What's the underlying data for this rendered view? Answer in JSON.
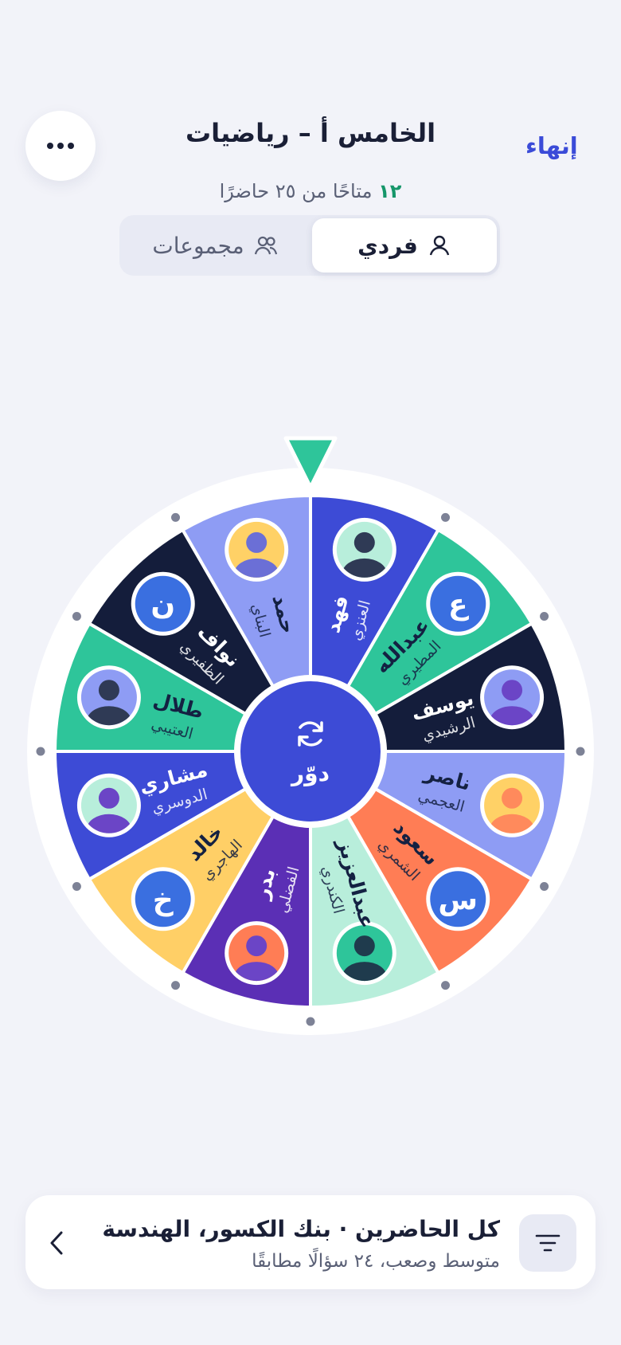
{
  "header": {
    "end_label": "إنهاء",
    "title": "الخامس أ – رياضيات",
    "available_count": "١٢",
    "available_text": "متاحًا من ٢٥ حاضرًا"
  },
  "mode_toggle": {
    "individual_label": "فردي",
    "groups_label": "مجموعات",
    "selected": "individual"
  },
  "wheel": {
    "spin_label": "دوّر",
    "segments": [
      {
        "first": "فهد",
        "last": "العنزي",
        "color": "#3d4bd6",
        "text": "#ffffff",
        "avatar": {
          "kind": "photo",
          "bg": "#b8eedb",
          "head": "#2f3a55",
          "body": "#2f3a55"
        }
      },
      {
        "first": "عبدالله",
        "last": "المطيري",
        "color": "#2ec59a",
        "text": "#142142",
        "avatar": {
          "kind": "initial",
          "letter": "ع",
          "bg": "#3a6fe0"
        }
      },
      {
        "first": "يوسف",
        "last": "الرشيدي",
        "color": "#141d3b",
        "text": "#ffffff",
        "avatar": {
          "kind": "photo",
          "bg": "#8e9cf4",
          "head": "#6b45c6",
          "body": "#6b45c6"
        }
      },
      {
        "first": "ناصر",
        "last": "العجمي",
        "color": "#8e9cf4",
        "text": "#142142",
        "avatar": {
          "kind": "photo",
          "bg": "#ffd166",
          "head": "#ff8a5c",
          "body": "#ff8a5c"
        }
      },
      {
        "first": "سعود",
        "last": "الشمري",
        "color": "#ff7d55",
        "text": "#142142",
        "avatar": {
          "kind": "initial",
          "letter": "س",
          "bg": "#3a6fe0"
        }
      },
      {
        "first": "عبدالعزيز",
        "last": "الكندري",
        "color": "#b8eedb",
        "text": "#142142",
        "avatar": {
          "kind": "photo",
          "bg": "#2ec59a",
          "head": "#1f3b4d",
          "body": "#1f3b4d"
        }
      },
      {
        "first": "بدر",
        "last": "الفضلي",
        "color": "#5b2fb5",
        "text": "#ffffff",
        "avatar": {
          "kind": "photo",
          "bg": "#ff7d55",
          "head": "#6b45c6",
          "body": "#6b45c6"
        }
      },
      {
        "first": "خالد",
        "last": "الهاجري",
        "color": "#ffcf66",
        "text": "#142142",
        "avatar": {
          "kind": "initial",
          "letter": "خ",
          "bg": "#3a6fe0"
        }
      },
      {
        "first": "مشاري",
        "last": "الدوسري",
        "color": "#3d4bd6",
        "text": "#ffffff",
        "avatar": {
          "kind": "photo",
          "bg": "#b8eedb",
          "head": "#6b45c6",
          "body": "#6b45c6"
        }
      },
      {
        "first": "طلال",
        "last": "العتيبي",
        "color": "#2ec59a",
        "text": "#142142",
        "avatar": {
          "kind": "photo",
          "bg": "#8e9cf4",
          "head": "#2f3a55",
          "body": "#2f3a55"
        }
      },
      {
        "first": "نواف",
        "last": "الظفيري",
        "color": "#141d3b",
        "text": "#ffffff",
        "avatar": {
          "kind": "initial",
          "letter": "ن",
          "bg": "#3a6fe0"
        }
      },
      {
        "first": "حمد",
        "last": "البناي",
        "color": "#8e9cf4",
        "text": "#142142",
        "avatar": {
          "kind": "photo",
          "bg": "#ffd166",
          "head": "#6b6fd6",
          "body": "#6b6fd6"
        }
      }
    ]
  },
  "filter_card": {
    "title": "كل الحاضرين · بنك الكسور، الهندسة",
    "subtitle": "متوسط وصعب، ٢٤ سؤالًا مطابقًا"
  },
  "colors": {
    "accent": "#3b4bd8",
    "pointer": "#2ec59a",
    "available_count": "#16966a",
    "background": "#f2f3f9"
  },
  "icons": {
    "menu": "more-horizontal-icon",
    "individual": "person-icon",
    "groups": "people-icon",
    "spin": "refresh-icon",
    "filter": "filter-icon",
    "chevron": "chevron-left-icon"
  }
}
